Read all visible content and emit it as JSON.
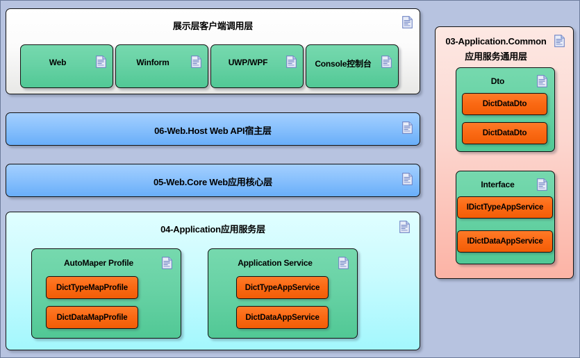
{
  "diagram": {
    "background_color": "#b7c3e0",
    "icon_name": "document-icon",
    "panels": [
      {
        "id": "presentation",
        "title": "展示层客户端调用层",
        "theme": "white",
        "children": [
          {
            "title": "Web",
            "theme": "green"
          },
          {
            "title": "Winform",
            "theme": "green"
          },
          {
            "title": "UWP/WPF",
            "theme": "green"
          },
          {
            "title": "Console控制台",
            "theme": "green"
          }
        ]
      },
      {
        "id": "web-host",
        "title": "06-Web.Host Web API宿主层",
        "theme": "blue",
        "children": []
      },
      {
        "id": "web-core",
        "title": "05-Web.Core Web应用核心层",
        "theme": "blue",
        "children": []
      },
      {
        "id": "application",
        "title": "04-Application应用服务层",
        "theme": "cyan",
        "children": [
          {
            "title": "AutoMaper Profile",
            "theme": "green",
            "items": [
              "DictTypeMapProfile",
              "DictDataMapProfile"
            ]
          },
          {
            "title": "Application Service",
            "theme": "green",
            "items": [
              "DictTypeAppService",
              "DictDataAppService"
            ]
          }
        ]
      },
      {
        "id": "application-common",
        "title_line1": "03-Application.Common",
        "title_line2": "应用服务通用层",
        "theme": "pink",
        "children": [
          {
            "title": "Dto",
            "theme": "green",
            "items": [
              "DictDataDto",
              "DictDataDto"
            ]
          },
          {
            "title": "Interface",
            "theme": "green",
            "items": [
              "IDictTypeAppService",
              "IDictDataAppService"
            ]
          }
        ]
      }
    ],
    "colors": {
      "green": "#68d2a5",
      "orange": "#fb6a15",
      "blue": "#8dc3fd",
      "cyan": "#c9fbfe",
      "pink": "#fcd6cf",
      "border": "#111111"
    }
  }
}
